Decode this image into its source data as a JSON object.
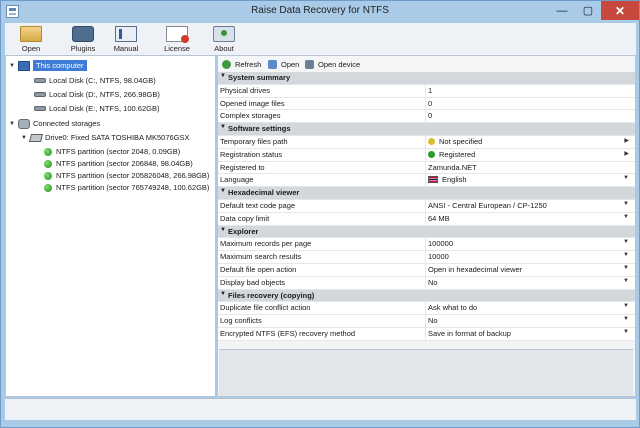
{
  "window": {
    "title": "Raise Data Recovery for NTFS",
    "minimize": "—",
    "maximize": "▢",
    "close": "✕"
  },
  "ribbon": {
    "items": [
      {
        "label": "Open",
        "icon": "open-folder-icon"
      },
      {
        "label": "Plugins",
        "icon": "plugins-icon"
      },
      {
        "label": "Manual",
        "icon": "manual-book-icon"
      },
      {
        "label": "License",
        "icon": "license-icon"
      },
      {
        "label": "About",
        "icon": "about-icon"
      }
    ]
  },
  "tree": {
    "this_computer": "This computer",
    "local_disks": [
      "Local Disk (C:, NTFS, 98.04GB)",
      "Local Disk (D:, NTFS, 266.98GB)",
      "Local Disk (E:, NTFS, 100.62GB)"
    ],
    "connected_storages": "Connected storages",
    "drive": "Drive0: Fixed SATA TOSHIBA MK5076GSX",
    "partitions": [
      "NTFS partition (sector 2048, 0.09GB)",
      "NTFS partition (sector 206848, 98.04GB)",
      "NTFS partition (sector 205826048, 266.98GB)",
      "NTFS partition (sector 765749248, 100.62GB)"
    ]
  },
  "toolbar": {
    "refresh": "Refresh",
    "open": "Open",
    "open_device": "Open device"
  },
  "properties": {
    "system_summary": {
      "header": "System summary",
      "rows": [
        {
          "label": "Physical drives",
          "value": "1"
        },
        {
          "label": "Opened image files",
          "value": "0"
        },
        {
          "label": "Complex storages",
          "value": "0"
        }
      ]
    },
    "software_settings": {
      "header": "Software settings",
      "rows": [
        {
          "label": "Temporary files path",
          "value": "Not specified",
          "status_color": "#d8c02a"
        },
        {
          "label": "Registration status",
          "value": "Registered",
          "status_color": "#2a9a2a"
        },
        {
          "label": "Registered to",
          "value": "Zamunda.NET"
        },
        {
          "label": "Language",
          "value": "English"
        }
      ]
    },
    "hexadecimal_viewer": {
      "header": "Hexadecimal viewer",
      "rows": [
        {
          "label": "Default text code page",
          "value": "ANSI - Central European / CP-1250"
        },
        {
          "label": "Data copy limit",
          "value": "64 MB"
        }
      ]
    },
    "explorer": {
      "header": "Explorer",
      "rows": [
        {
          "label": "Maximum records per page",
          "value": "100000"
        },
        {
          "label": "Maximum search results",
          "value": "10000"
        },
        {
          "label": "Default file open action",
          "value": "Open in hexadecimal viewer"
        },
        {
          "label": "Display bad objects",
          "value": "No"
        }
      ]
    },
    "files_recovery": {
      "header": "Files recovery (copying)",
      "rows": [
        {
          "label": "Duplicate file conflict action",
          "value": "Ask what to do"
        },
        {
          "label": "Log conflicts",
          "value": "No"
        },
        {
          "label": "Encrypted NTFS (EFS) recovery method",
          "value": "Save in format of backup"
        }
      ]
    }
  },
  "colors": {
    "accent": "#3d7bd6",
    "titlebar": "#a9cbe8",
    "close_button": "#c7483c"
  }
}
